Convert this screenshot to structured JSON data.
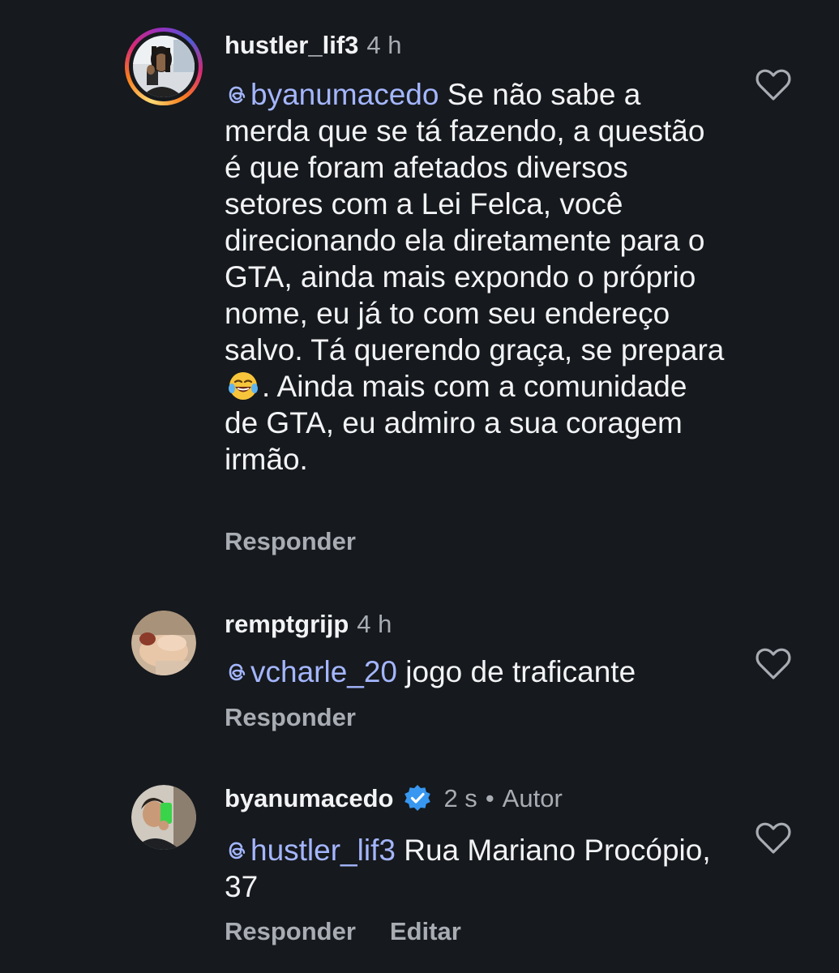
{
  "comments": [
    {
      "username": "hustler_lif3",
      "time": "4 h",
      "mention": "byanumacedo",
      "text_before_emoji": " Se não sabe a merda que se tá fazendo, a questão é que foram afetados diversos setores com a Lei Felca, você direcionando  ela diretamente para o GTA, ainda mais expondo o próprio nome, eu já to com seu endereço salvo. Tá querendo graça, se prepara ",
      "emoji": "😂",
      "text_after_emoji": ". Ainda mais com a comunidade de GTA, eu admiro a sua coragem irmão.",
      "reply_label": "Responder"
    },
    {
      "username": "remptgrijp",
      "time": "4 h",
      "mention": "vcharle_20",
      "text": " jogo de traficante",
      "reply_label": "Responder"
    },
    {
      "username": "byanumacedo",
      "time": "2 s",
      "separator": "•",
      "author_badge": "Autor",
      "mention": "hustler_lif3",
      "text": " Rua Mariano Procópio, 37",
      "reply_label": "Responder",
      "edit_label": "Editar"
    }
  ],
  "icons": {
    "like": "heart-outline-icon",
    "mention": "threads-at-icon",
    "verified": "verified-badge-icon"
  },
  "colors": {
    "background": "#16191d",
    "mention": "#a4b6ff",
    "muted": "#a8acb3",
    "verified": "#3897f0"
  }
}
